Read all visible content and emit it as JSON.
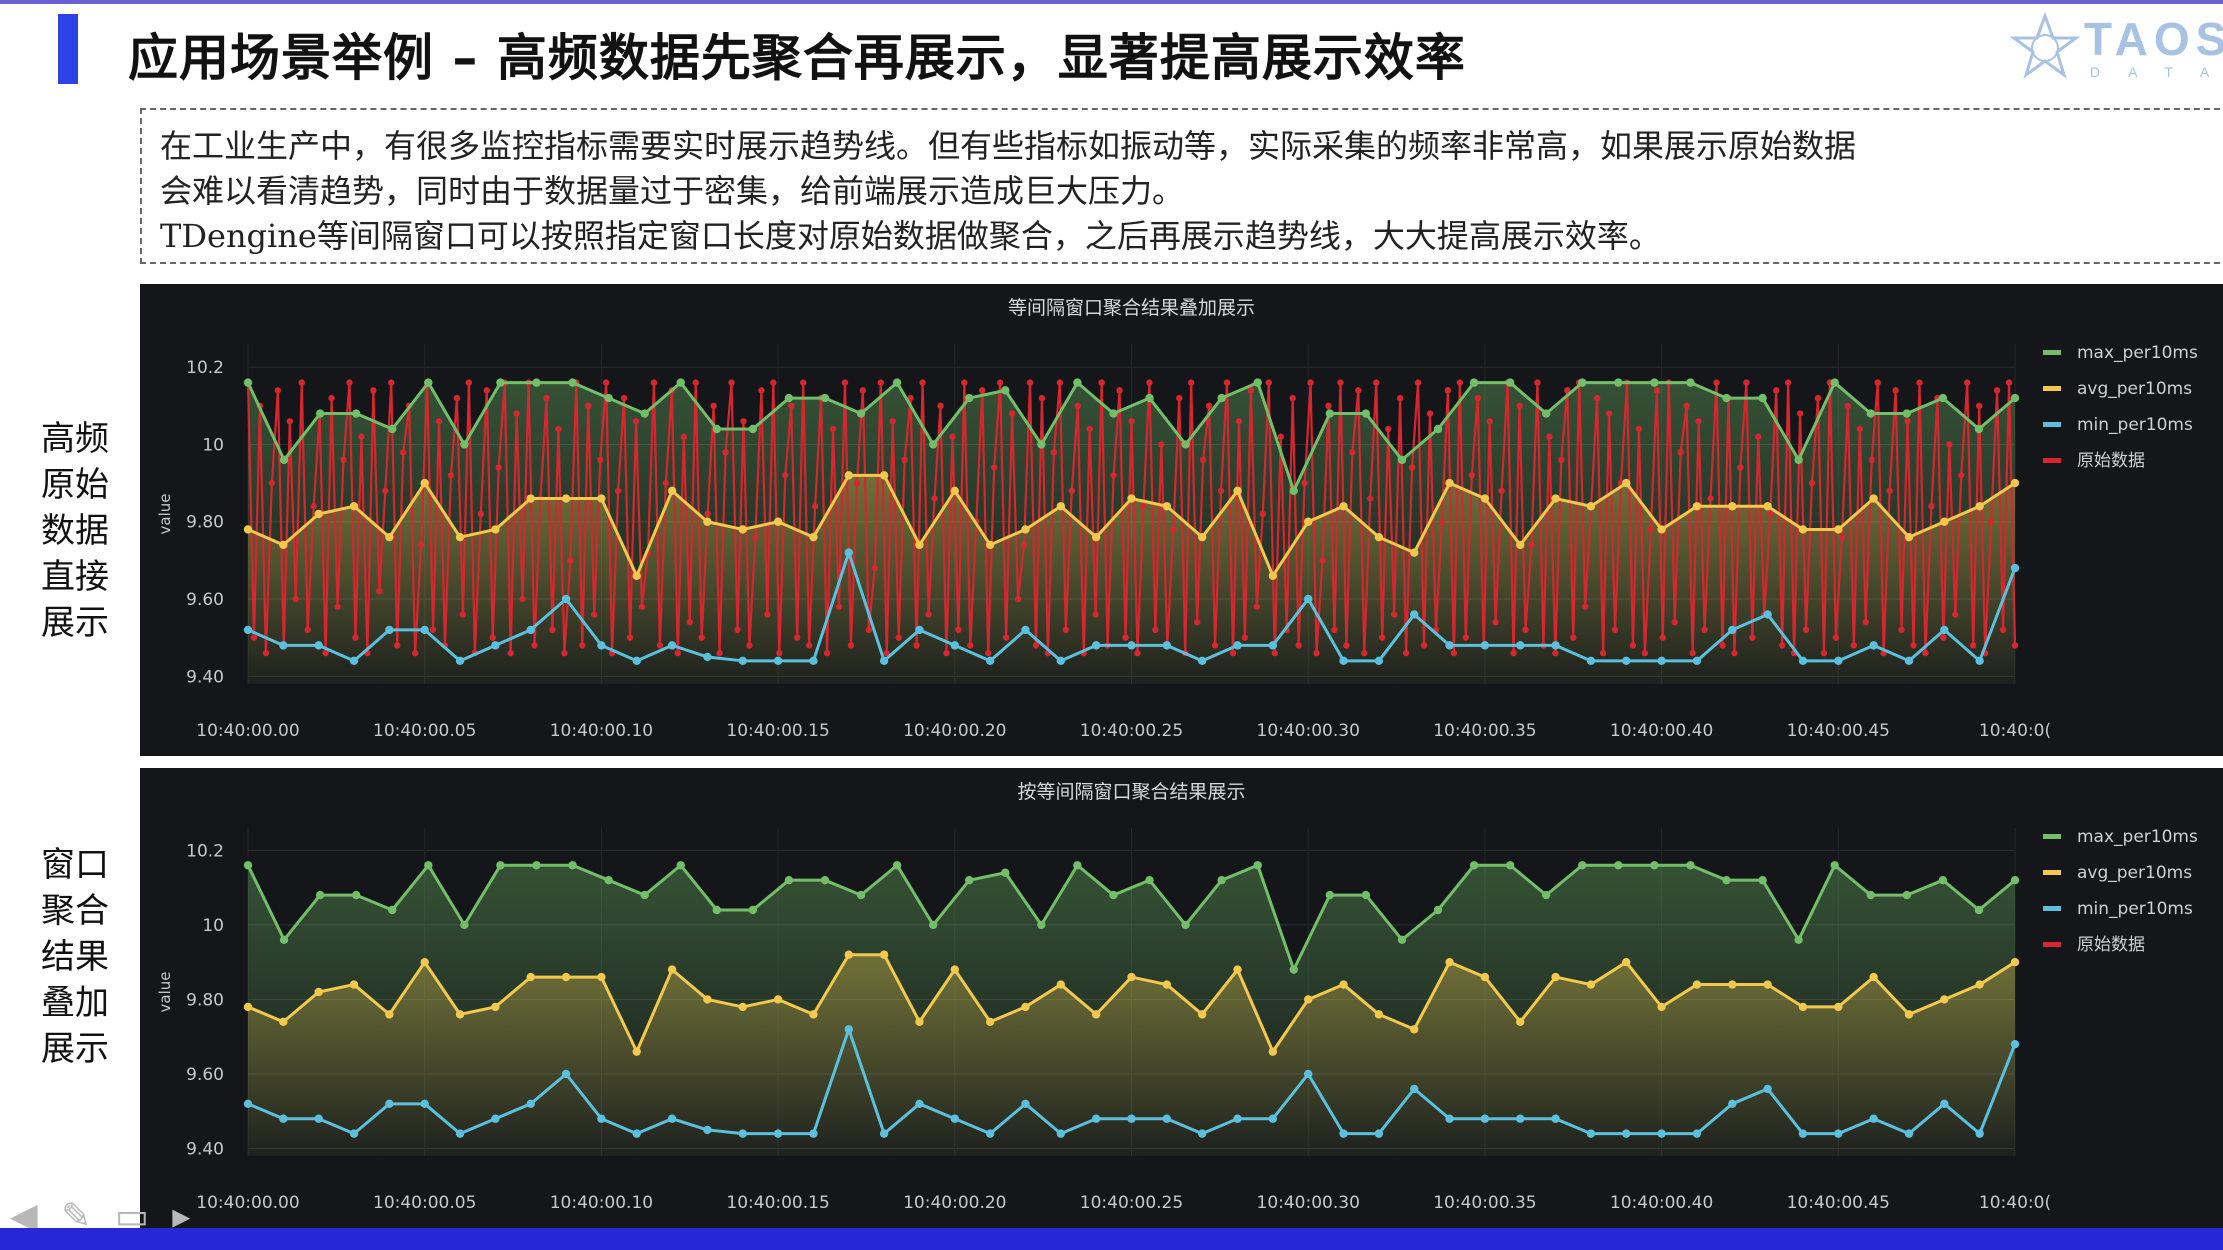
{
  "slide": {
    "title": "应用场景举例 – 高频数据先聚合再展示，显著提高展示效率",
    "logo_text": "TAOS",
    "logo_sub": "DATA",
    "description": [
      "在工业生产中，有很多监控指标需要实时展示趋势线。但有些指标如振动等，实际采集的频率非常高，如果展示原始数据",
      "会难以看清趋势，同时由于数据量过于密集，给前端展示造成巨大压力。",
      "TDengine等间隔窗口可以按照指定窗口长度对原始数据做聚合，之后再展示趋势线，大大提高展示效率。"
    ],
    "side_label_top": "高频原始数据直接展示",
    "side_label_bottom": "窗口聚合结果叠加展示"
  },
  "colors": {
    "max": "#73bf69",
    "avg": "#f2c94c",
    "min": "#5bc0de",
    "raw": "#d7262f",
    "panel_bg": "#141619",
    "tick": "#c8c8c8"
  },
  "chart_data": [
    {
      "type": "line",
      "title": "等间隔窗口聚合结果叠加展示",
      "ylabel": "value",
      "ylim": [
        9.38,
        10.26
      ],
      "yticks": [
        "10.2",
        "10",
        "9.80",
        "9.60",
        "9.40"
      ],
      "xticks": [
        "10:40:00.00",
        "10:40:00.05",
        "10:40:00.10",
        "10:40:00.15",
        "10:40:00.20",
        "10:40:00.25",
        "10:40:00.30",
        "10:40:00.35",
        "10:40:00.40",
        "10:40:00.45",
        "10:40:0("
      ],
      "legend": [
        "max_per10ms",
        "avg_per10ms",
        "min_per10ms",
        "原始数据"
      ],
      "legend_position": "right",
      "series": [
        {
          "name": "max_per10ms",
          "values": [
            10.16,
            9.96,
            10.08,
            10.08,
            10.04,
            10.16,
            10.0,
            10.16,
            10.16,
            10.16,
            10.12,
            10.08,
            10.16,
            10.04,
            10.04,
            10.12,
            10.12,
            10.08,
            10.16,
            10.0,
            10.12,
            10.14,
            10.0,
            10.16,
            10.08,
            10.12,
            10.0,
            10.12,
            10.16,
            9.88,
            10.08,
            10.08,
            9.96,
            10.04,
            10.16,
            10.16,
            10.08,
            10.16,
            10.16,
            10.16,
            10.16,
            10.12,
            10.12,
            9.96,
            10.16,
            10.08,
            10.08,
            10.12,
            10.04,
            10.12
          ]
        },
        {
          "name": "avg_per10ms",
          "values": [
            9.78,
            9.74,
            9.82,
            9.84,
            9.76,
            9.9,
            9.76,
            9.78,
            9.86,
            9.86,
            9.86,
            9.66,
            9.88,
            9.8,
            9.78,
            9.8,
            9.76,
            9.92,
            9.92,
            9.74,
            9.88,
            9.74,
            9.78,
            9.84,
            9.76,
            9.86,
            9.84,
            9.76,
            9.88,
            9.66,
            9.8,
            9.84,
            9.76,
            9.72,
            9.9,
            9.86,
            9.74,
            9.86,
            9.84,
            9.9,
            9.78,
            9.84,
            9.84,
            9.84,
            9.78,
            9.78,
            9.86,
            9.76,
            9.8,
            9.84,
            9.9
          ]
        },
        {
          "name": "min_per10ms",
          "values": [
            9.52,
            9.48,
            9.48,
            9.44,
            9.52,
            9.52,
            9.44,
            9.48,
            9.52,
            9.6,
            9.48,
            9.44,
            9.48,
            9.45,
            9.44,
            9.44,
            9.44,
            9.72,
            9.44,
            9.52,
            9.48,
            9.44,
            9.52,
            9.44,
            9.48,
            9.48,
            9.48,
            9.44,
            9.48,
            9.48,
            9.6,
            9.44,
            9.44,
            9.56,
            9.48,
            9.48,
            9.48,
            9.48,
            9.44,
            9.44,
            9.44,
            9.44,
            9.52,
            9.56,
            9.44,
            9.44,
            9.48,
            9.44,
            9.52,
            9.44,
            9.68
          ]
        },
        {
          "name": "原始数据",
          "values": [
            10.16,
            9.5,
            10.1,
            9.46,
            9.9,
            10.14,
            9.48,
            10.06,
            9.6,
            10.16,
            9.52,
            9.84,
            10.08,
            9.46,
            10.12,
            9.58,
            9.96,
            10.16,
            9.5,
            10.02,
            9.46,
            10.14,
            9.62,
            9.88,
            10.16,
            9.48,
            9.98,
            10.1,
            9.46,
            9.74,
            10.16,
            9.52,
            10.06,
            9.48,
            9.92,
            10.12,
            9.56,
            10.16,
            9.46,
            9.82,
            10.14,
            9.5,
            9.94,
            10.16,
            9.46,
            10.08,
            9.6,
            10.16,
            9.48,
            9.86,
            10.12,
            9.52,
            10.04,
            9.46,
            9.7,
            10.16,
            9.48,
            10.1,
            9.56,
            9.96,
            10.16,
            9.46,
            9.88,
            10.12,
            9.5,
            10.06,
            9.58,
            9.72,
            10.16,
            9.48,
            9.9,
            10.14,
            9.46,
            10.02,
            9.54,
            10.16,
            9.5,
            9.82,
            10.1,
            9.46,
            9.98,
            10.16,
            9.52,
            10.06,
            9.48,
            9.76,
            10.14,
            9.56,
            10.16,
            9.46,
            9.92,
            10.1,
            9.5,
            10.16,
            9.48,
            9.84,
            10.12,
            9.46,
            10.04,
            9.58,
            10.16,
            9.48,
            9.9,
            10.14,
            9.52,
            9.68,
            10.16,
            9.46,
            10.06,
            9.5,
            9.96,
            10.12,
            9.48,
            10.16,
            9.56,
            9.86,
            10.1,
            9.46,
            10.02,
            9.52,
            10.16,
            9.48,
            9.8,
            10.14,
            9.46,
            9.94,
            10.16,
            9.5,
            10.08,
            9.6,
            9.74,
            10.16,
            9.48,
            10.12,
            9.46,
            9.98,
            10.16,
            9.52,
            9.88,
            10.1,
            9.46,
            10.04,
            9.56,
            10.16,
            9.48,
            9.92,
            10.14,
            9.5,
            10.06,
            9.46,
            9.84,
            10.16,
            9.52,
            10.0,
            9.48,
            9.78,
            10.12,
            9.46,
            10.16,
            9.54,
            9.96,
            10.1,
            9.48,
            9.88,
            10.16,
            9.46,
            10.06,
            9.5,
            10.14,
            9.58,
            9.82,
            10.16,
            9.46,
            10.02,
            9.52,
            10.12,
            9.48,
            9.9,
            10.16,
            9.46,
            9.7,
            10.1,
            9.52,
            10.16,
            9.48,
            9.98,
            10.14,
            9.46,
            9.86,
            10.16,
            9.5,
            10.04,
            9.56,
            10.12,
            9.46,
            9.94,
            10.16,
            9.48,
            10.08,
            9.52,
            9.8,
            10.14,
            9.46,
            10.16,
            9.5,
            9.92,
            10.12,
            9.48,
            10.06,
            9.54,
            9.88,
            10.16,
            9.46,
            10.1,
            9.52,
            9.74,
            10.16,
            9.48,
            10.02,
            9.46,
            9.96,
            10.14,
            9.5,
            10.16,
            9.58,
            9.84,
            10.12,
            9.46,
            10.08,
            9.52,
            9.9,
            10.16,
            9.48,
            10.04,
            9.46,
            9.78,
            10.14,
            9.5,
            10.16,
            9.54,
            9.98,
            10.1,
            9.46,
            10.06,
            9.52,
            9.86,
            10.16,
            9.48,
            10.12,
            9.46,
            9.94,
            10.16,
            9.5,
            10.02,
            9.56,
            9.82,
            10.14,
            9.48,
            10.16,
            9.46,
            10.08,
            9.52,
            9.9,
            10.12,
            9.46,
            10.16,
            9.5,
            9.76,
            10.1,
            9.48,
            10.04,
            9.54,
            9.96,
            10.16,
            9.46,
            9.88,
            10.14,
            9.52,
            10.06,
            9.48,
            10.16,
            9.46,
            9.84,
            10.12,
            9.5,
            10.0,
            9.56,
            9.92,
            10.16,
            9.48,
            10.1,
            9.46,
            9.8,
            10.14,
            9.52,
            10.16,
            9.48
          ]
        }
      ]
    },
    {
      "type": "line",
      "title": "按等间隔窗口聚合结果展示",
      "ylabel": "value",
      "ylim": [
        9.38,
        10.26
      ],
      "yticks": [
        "10.2",
        "10",
        "9.80",
        "9.60",
        "9.40"
      ],
      "xticks": [
        "10:40:00.00",
        "10:40:00.05",
        "10:40:00.10",
        "10:40:00.15",
        "10:40:00.20",
        "10:40:00.25",
        "10:40:00.30",
        "10:40:00.35",
        "10:40:00.40",
        "10:40:00.45",
        "10:40:0("
      ],
      "legend": [
        "max_per10ms",
        "avg_per10ms",
        "min_per10ms",
        "原始数据"
      ],
      "legend_position": "right",
      "series": [
        {
          "name": "max_per10ms",
          "values": [
            10.16,
            9.96,
            10.08,
            10.08,
            10.04,
            10.16,
            10.0,
            10.16,
            10.16,
            10.16,
            10.12,
            10.08,
            10.16,
            10.04,
            10.04,
            10.12,
            10.12,
            10.08,
            10.16,
            10.0,
            10.12,
            10.14,
            10.0,
            10.16,
            10.08,
            10.12,
            10.0,
            10.12,
            10.16,
            9.88,
            10.08,
            10.08,
            9.96,
            10.04,
            10.16,
            10.16,
            10.08,
            10.16,
            10.16,
            10.16,
            10.16,
            10.12,
            10.12,
            9.96,
            10.16,
            10.08,
            10.08,
            10.12,
            10.04,
            10.12
          ]
        },
        {
          "name": "avg_per10ms",
          "values": [
            9.78,
            9.74,
            9.82,
            9.84,
            9.76,
            9.9,
            9.76,
            9.78,
            9.86,
            9.86,
            9.86,
            9.66,
            9.88,
            9.8,
            9.78,
            9.8,
            9.76,
            9.92,
            9.92,
            9.74,
            9.88,
            9.74,
            9.78,
            9.84,
            9.76,
            9.86,
            9.84,
            9.76,
            9.88,
            9.66,
            9.8,
            9.84,
            9.76,
            9.72,
            9.9,
            9.86,
            9.74,
            9.86,
            9.84,
            9.9,
            9.78,
            9.84,
            9.84,
            9.84,
            9.78,
            9.78,
            9.86,
            9.76,
            9.8,
            9.84,
            9.9
          ]
        },
        {
          "name": "min_per10ms",
          "values": [
            9.52,
            9.48,
            9.48,
            9.44,
            9.52,
            9.52,
            9.44,
            9.48,
            9.52,
            9.6,
            9.48,
            9.44,
            9.48,
            9.45,
            9.44,
            9.44,
            9.44,
            9.72,
            9.44,
            9.52,
            9.48,
            9.44,
            9.52,
            9.44,
            9.48,
            9.48,
            9.48,
            9.44,
            9.48,
            9.48,
            9.6,
            9.44,
            9.44,
            9.56,
            9.48,
            9.48,
            9.48,
            9.48,
            9.44,
            9.44,
            9.44,
            9.44,
            9.52,
            9.56,
            9.44,
            9.44,
            9.48,
            9.44,
            9.52,
            9.44,
            9.68
          ]
        }
      ]
    }
  ]
}
